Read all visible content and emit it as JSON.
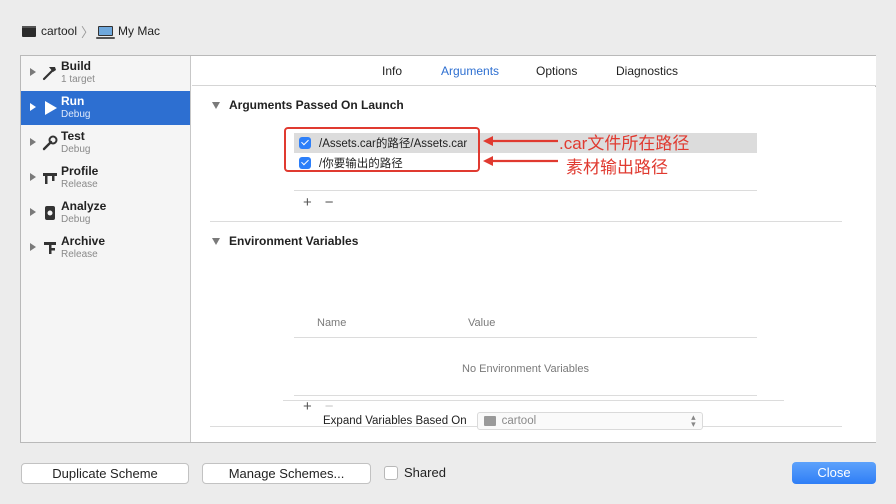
{
  "toolbar": {
    "scheme": "cartool",
    "destination": "My Mac"
  },
  "sidebar": {
    "items": [
      {
        "name": "Build",
        "sub": "1 target",
        "icon": "hammer-icon",
        "selected": false
      },
      {
        "name": "Run",
        "sub": "Debug",
        "icon": "play-icon",
        "selected": true
      },
      {
        "name": "Test",
        "sub": "Debug",
        "icon": "wrench-icon",
        "selected": false
      },
      {
        "name": "Profile",
        "sub": "Release",
        "icon": "caliper-icon",
        "selected": false
      },
      {
        "name": "Analyze",
        "sub": "Debug",
        "icon": "analyze-icon",
        "selected": false
      },
      {
        "name": "Archive",
        "sub": "Release",
        "icon": "archive-icon",
        "selected": false
      }
    ]
  },
  "tabs": {
    "items": [
      {
        "label": "Info",
        "active": false
      },
      {
        "label": "Arguments",
        "active": true
      },
      {
        "label": "Options",
        "active": false
      },
      {
        "label": "Diagnostics",
        "active": false
      }
    ]
  },
  "arguments": {
    "title": "Arguments Passed On Launch",
    "items": [
      {
        "value": "/Assets.car的路径/Assets.car",
        "checked": true
      },
      {
        "value": "/你要输出的路径",
        "checked": true
      }
    ],
    "add": "+",
    "remove": "−"
  },
  "environment": {
    "title": "Environment Variables",
    "col_name": "Name",
    "col_value": "Value",
    "empty": "No Environment Variables",
    "add": "+",
    "remove": "−"
  },
  "expand": {
    "label": "Expand Variables Based On",
    "value": "cartool"
  },
  "annotations": {
    "car_path": ".car文件所在路径",
    "output_path": "素材输出路径",
    "color": "#e03a30"
  },
  "buttons": {
    "duplicate": "Duplicate Scheme",
    "manage": "Manage Schemes...",
    "shared": "Shared",
    "close": "Close"
  },
  "colors": {
    "accent": "#2d6fd1",
    "close_button": "#3b86f7"
  }
}
